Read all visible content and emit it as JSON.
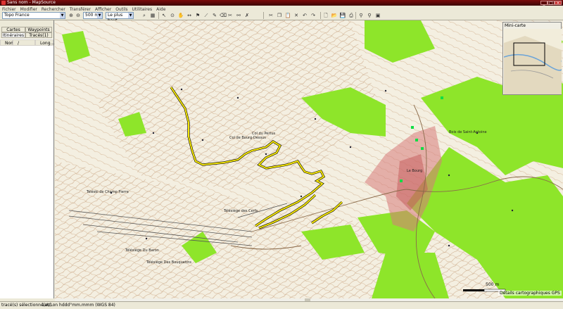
{
  "window": {
    "title": "Sans nom - MapSource"
  },
  "menu": [
    "Fichier",
    "Modifier",
    "Rechercher",
    "Transférer",
    "Afficher",
    "Outils",
    "Utilitaires",
    "Aide"
  ],
  "toolbar": {
    "product": "Topo France",
    "zoom_scale": "500 m",
    "detail_level": "Le plus haut"
  },
  "left_panel": {
    "tabs_top": [
      "Cartes",
      "Waypoints"
    ],
    "tabs_bottom": [
      "Itinéraires",
      "Tracés(1)"
    ],
    "columns": [
      "Nom",
      "/",
      "Long..."
    ]
  },
  "map": {
    "minimap_title": "Mini-carte",
    "scale_label": "500 m",
    "detail_text": "Détails cartographiques GPS",
    "labels": [
      "Col de Bourg-Dessus",
      "Téléski de Champ Pierre",
      "Télésiège des Cerfs",
      "Télésiège Du Baron",
      "Télésiège Des Bouquetins",
      "Col du Pertus",
      "Le Bourg",
      "Bois de Saint-Antoine"
    ],
    "colors": {
      "forest": "#8ee52a",
      "track": "#f5e600",
      "town": "#d77a7a",
      "contour": "#c9a98a"
    }
  },
  "status": {
    "left": "tracé(s) sélectionné(es)",
    "coords": "Lat/Lon hddd°mm.mmm (WGS 84)"
  }
}
